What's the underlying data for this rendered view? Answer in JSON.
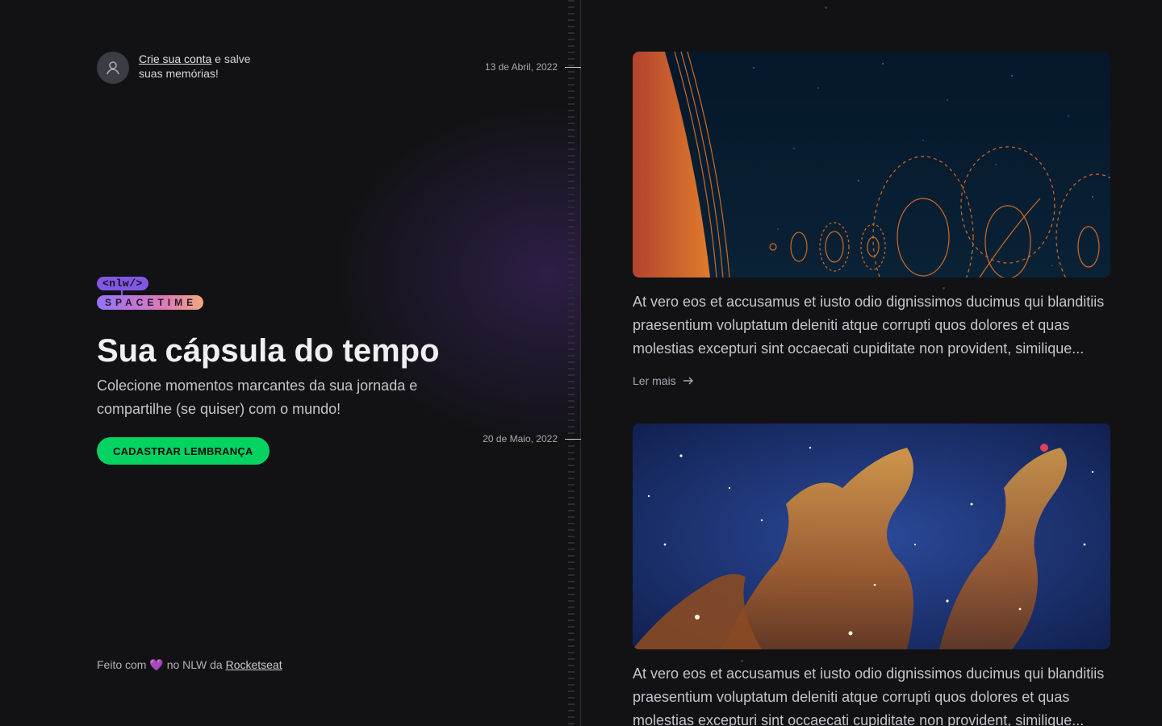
{
  "signin": {
    "link_text": "Crie sua conta",
    "rest_text": " e salve suas memórias!",
    "avatar_icon": "user-icon"
  },
  "brand": {
    "logo_top": "<nlw/>",
    "logo_bottom": "SPACETIME"
  },
  "hero": {
    "title": "Sua cápsula do tempo",
    "subtitle": "Colecione momentos marcantes da sua jornada e compartilhe (se quiser) com o mundo!",
    "cta_label": "CADASTRAR LEMBRANÇA"
  },
  "footer": {
    "prefix": "Feito com",
    "heart": "💜",
    "middle": "no NLW da",
    "link": "Rocketseat"
  },
  "memories": [
    {
      "date": "13 de Abril, 2022",
      "excerpt": "At vero eos et accusamus et iusto odio dignissimos ducimus qui blanditiis praesentium voluptatum deleniti atque corrupti quos dolores et quas molestias excepturi sint occaecati cupiditate non provident, similique...",
      "read_more": "Ler mais",
      "image": "solar-system-illustration"
    },
    {
      "date": "20 de Maio, 2022",
      "excerpt": "At vero eos et accusamus et iusto odio dignissimos ducimus qui blanditiis praesentium voluptatum deleniti atque corrupti quos dolores et quas molestias excepturi sint occaecati cupiditate non provident, similique...",
      "image": "pillars-of-creation-nebula"
    }
  ],
  "colors": {
    "background": "#121215",
    "accent_green": "#04d361",
    "brand_purple": "#8257e5",
    "planet_orange": "#e07b2c",
    "space_navy": "#071d2e"
  }
}
